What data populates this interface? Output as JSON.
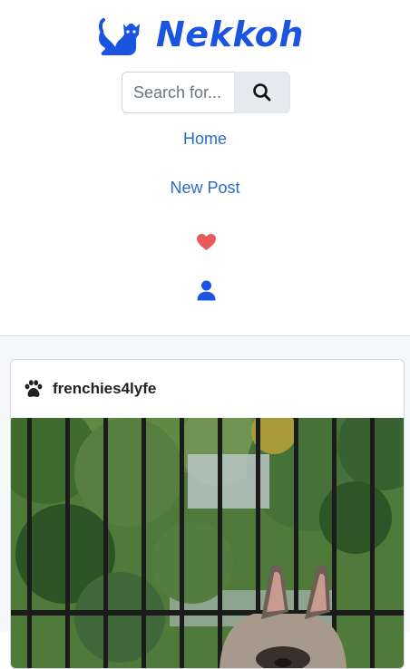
{
  "brand": {
    "name": "Nekkoh",
    "icon": "cat-icon",
    "color": "#1a54e0"
  },
  "search": {
    "placeholder": "Search for...",
    "value": "",
    "button_icon": "search-icon"
  },
  "nav": {
    "home_label": "Home",
    "new_post_label": "New Post",
    "favorites_icon": "heart-icon",
    "profile_icon": "user-icon",
    "link_color": "#2c6bc8",
    "heart_color": "#ea5a5a"
  },
  "post": {
    "username": "frenchies4lyfe",
    "user_icon": "paw-icon",
    "image_description": "french-bulldog-on-balcony"
  }
}
